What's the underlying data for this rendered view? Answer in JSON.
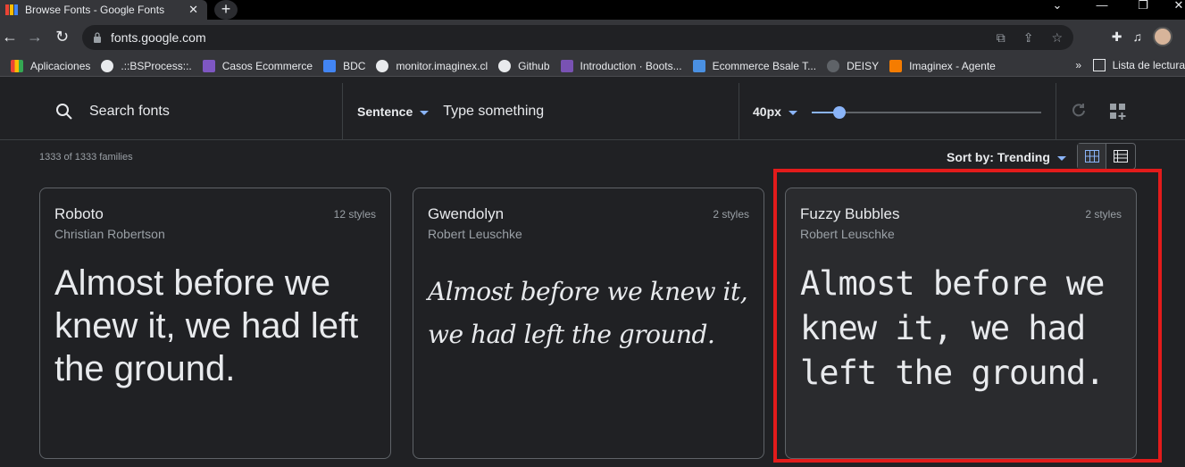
{
  "browser": {
    "tab_title": "Browse Fonts - Google Fonts",
    "url": "fonts.google.com",
    "bookmarks": [
      {
        "label": "Aplicaciones",
        "icon": "apps-grid-icon",
        "color": "#ea4335"
      },
      {
        "label": ".::BSProcess::.",
        "icon": "globe-icon",
        "color": "#e8eaed"
      },
      {
        "label": "Casos Ecommerce",
        "icon": "list-icon",
        "color": "#7e57c2"
      },
      {
        "label": "BDC",
        "icon": "board-icon",
        "color": "#4285f4"
      },
      {
        "label": "monitor.imaginex.cl",
        "icon": "globe-icon",
        "color": "#e8eaed"
      },
      {
        "label": "Github",
        "icon": "github-icon",
        "color": "#e8eaed"
      },
      {
        "label": "Introduction · Boots...",
        "icon": "bootstrap-icon",
        "color": "#7952b3"
      },
      {
        "label": "Ecommerce Bsale T...",
        "icon": "person-icon",
        "color": "#4a90e2"
      },
      {
        "label": "DEISY",
        "icon": "link-icon",
        "color": "#5f6368"
      },
      {
        "label": "Imaginex - Agente",
        "icon": "bolt-icon",
        "color": "#f57c00"
      }
    ],
    "more_bookmarks": "»",
    "reading_list": "Lista de lectura"
  },
  "controls": {
    "search_placeholder": "Search fonts",
    "preview_mode": "Sentence",
    "preview_placeholder": "Type something",
    "font_size": "40px",
    "font_size_fraction": 0.12
  },
  "results": {
    "count": "1333 of 1333 families",
    "sort_label": "Sort by: Trending"
  },
  "cards": [
    {
      "name": "Roboto",
      "author": "Christian Robertson",
      "styles": "12 styles",
      "sample": "Almost before we knew it, we had left the ground."
    },
    {
      "name": "Gwendolyn",
      "author": "Robert Leuschke",
      "styles": "2 styles",
      "sample": "Almost before we knew it, we had left the ground."
    },
    {
      "name": "Fuzzy Bubbles",
      "author": "Robert Leuschke",
      "styles": "2 styles",
      "sample": "Almost before we knew it, we had left the ground."
    }
  ],
  "colors": {
    "accent": "#8ab4f8",
    "highlight_border": "#e21b1b",
    "background": "#202124"
  }
}
